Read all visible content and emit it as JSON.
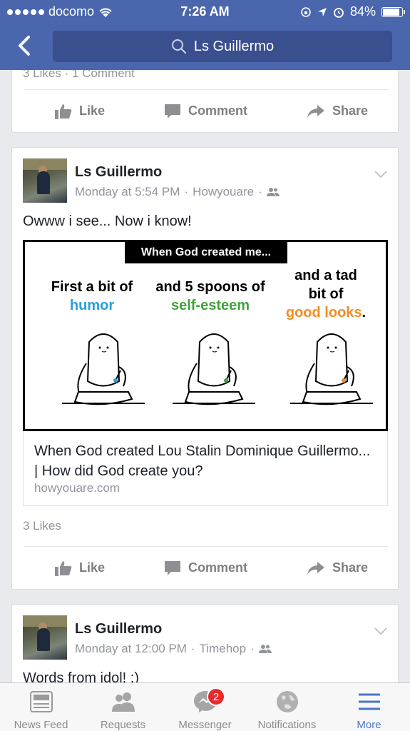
{
  "status_bar": {
    "carrier": "docomo",
    "time": "7:26 AM",
    "battery": "84%"
  },
  "search": {
    "text": "Ls Guillermo"
  },
  "top_card": {
    "likes_partial": "3 Likes · 1 Comment"
  },
  "actions": {
    "like": "Like",
    "comment": "Comment",
    "share": "Share"
  },
  "post1": {
    "author": "Ls Guillermo",
    "time": "Monday at 5:54 PM",
    "source": "Howyouare",
    "text": "Owww i see... Now i know!",
    "comic": {
      "title": "When God created me...",
      "panel1_line1": "First a bit of",
      "panel1_line2": "humor",
      "panel2_line1": "and 5 spoons of",
      "panel2_line2": "self-esteem",
      "panel3_line1": "and a tad",
      "panel3_line2": "bit of",
      "panel3_line3": "good looks",
      "panel3_dot": "."
    },
    "link_title": "When God created Lou Stalin Dominique Guillermo... | How did God create you?",
    "link_host": "howyouare.com",
    "likes": "3 Likes"
  },
  "post2": {
    "author": "Ls Guillermo",
    "time": "Monday at 12:00 PM",
    "source": "Timehop",
    "text": "Words from idol! :)"
  },
  "tabs": [
    {
      "label": "News Feed"
    },
    {
      "label": "Requests"
    },
    {
      "label": "Messenger",
      "badge": "2"
    },
    {
      "label": "Notifications"
    },
    {
      "label": "More"
    }
  ],
  "colors": {
    "header": "#4a66ad",
    "active_tab": "#4a76c9",
    "badge": "#e82a2a"
  }
}
